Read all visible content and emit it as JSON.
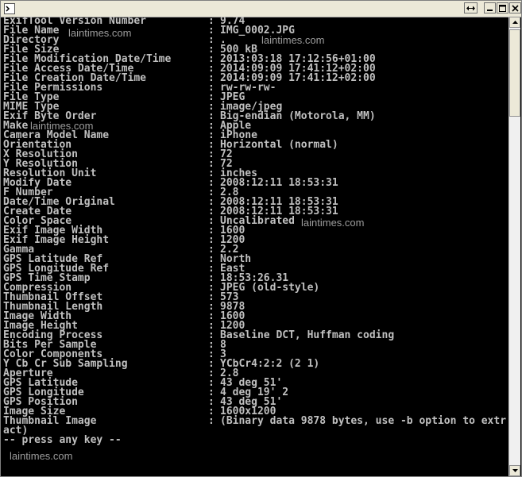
{
  "window": {
    "icon": "console-icon",
    "controls": [
      "resize-icon",
      "minimize-icon",
      "maximize-icon",
      "close-icon"
    ]
  },
  "output": {
    "fields": [
      {
        "key": "ExifTool Version Number",
        "value": "9.74"
      },
      {
        "key": "File Name",
        "value": "IMG_0002.JPG"
      },
      {
        "key": "Directory",
        "value": "."
      },
      {
        "key": "File Size",
        "value": "500 kB"
      },
      {
        "key": "File Modification Date/Time",
        "value": "2013:03:18 17:12:56+01:00"
      },
      {
        "key": "File Access Date/Time",
        "value": "2014:09:09 17:41:12+02:00"
      },
      {
        "key": "File Creation Date/Time",
        "value": "2014:09:09 17:41:12+02:00"
      },
      {
        "key": "File Permissions",
        "value": "rw-rw-rw-"
      },
      {
        "key": "File Type",
        "value": "JPEG"
      },
      {
        "key": "MIME Type",
        "value": "image/jpeg"
      },
      {
        "key": "Exif Byte Order",
        "value": "Big-endian (Motorola, MM)"
      },
      {
        "key": "Make",
        "value": "Apple"
      },
      {
        "key": "Camera Model Name",
        "value": "iPhone"
      },
      {
        "key": "Orientation",
        "value": "Horizontal (normal)"
      },
      {
        "key": "X Resolution",
        "value": "72"
      },
      {
        "key": "Y Resolution",
        "value": "72"
      },
      {
        "key": "Resolution Unit",
        "value": "inches"
      },
      {
        "key": "Modify Date",
        "value": "2008:12:11 18:53:31"
      },
      {
        "key": "F Number",
        "value": "2.8"
      },
      {
        "key": "Date/Time Original",
        "value": "2008:12:11 18:53:31"
      },
      {
        "key": "Create Date",
        "value": "2008:12:11 18:53:31"
      },
      {
        "key": "Color Space",
        "value": "Uncalibrated"
      },
      {
        "key": "Exif Image Width",
        "value": "1600"
      },
      {
        "key": "Exif Image Height",
        "value": "1200"
      },
      {
        "key": "Gamma",
        "value": "2.2"
      },
      {
        "key": "GPS Latitude Ref",
        "value": "North"
      },
      {
        "key": "GPS Longitude Ref",
        "value": "East"
      },
      {
        "key": "GPS Time Stamp",
        "value": "18:53:26.31"
      },
      {
        "key": "Compression",
        "value": "JPEG (old-style)"
      },
      {
        "key": "Thumbnail Offset",
        "value": "573"
      },
      {
        "key": "Thumbnail Length",
        "value": "9878"
      },
      {
        "key": "Image Width",
        "value": "1600"
      },
      {
        "key": "Image Height",
        "value": "1200"
      },
      {
        "key": "Encoding Process",
        "value": "Baseline DCT, Huffman coding"
      },
      {
        "key": "Bits Per Sample",
        "value": "8"
      },
      {
        "key": "Color Components",
        "value": "3"
      },
      {
        "key": "Y Cb Cr Sub Sampling",
        "value": "YCbCr4:2:2 (2 1)"
      },
      {
        "key": "Aperture",
        "value": "2.8"
      },
      {
        "key": "GPS Latitude",
        "value": "43 deg 51'"
      },
      {
        "key": "GPS Longitude",
        "value": "4 deg 19' 2"
      },
      {
        "key": "GPS Position",
        "value": "43 deg 51'"
      },
      {
        "key": "Image Size",
        "value": "1600x1200"
      },
      {
        "key": "Thumbnail Image",
        "value": "(Binary data 9878 bytes, use -b option to extr"
      }
    ],
    "separator": ":",
    "wrap_line": "act)",
    "prompt": "-- press any key --"
  },
  "watermark": {
    "text": "laintimes.com"
  }
}
